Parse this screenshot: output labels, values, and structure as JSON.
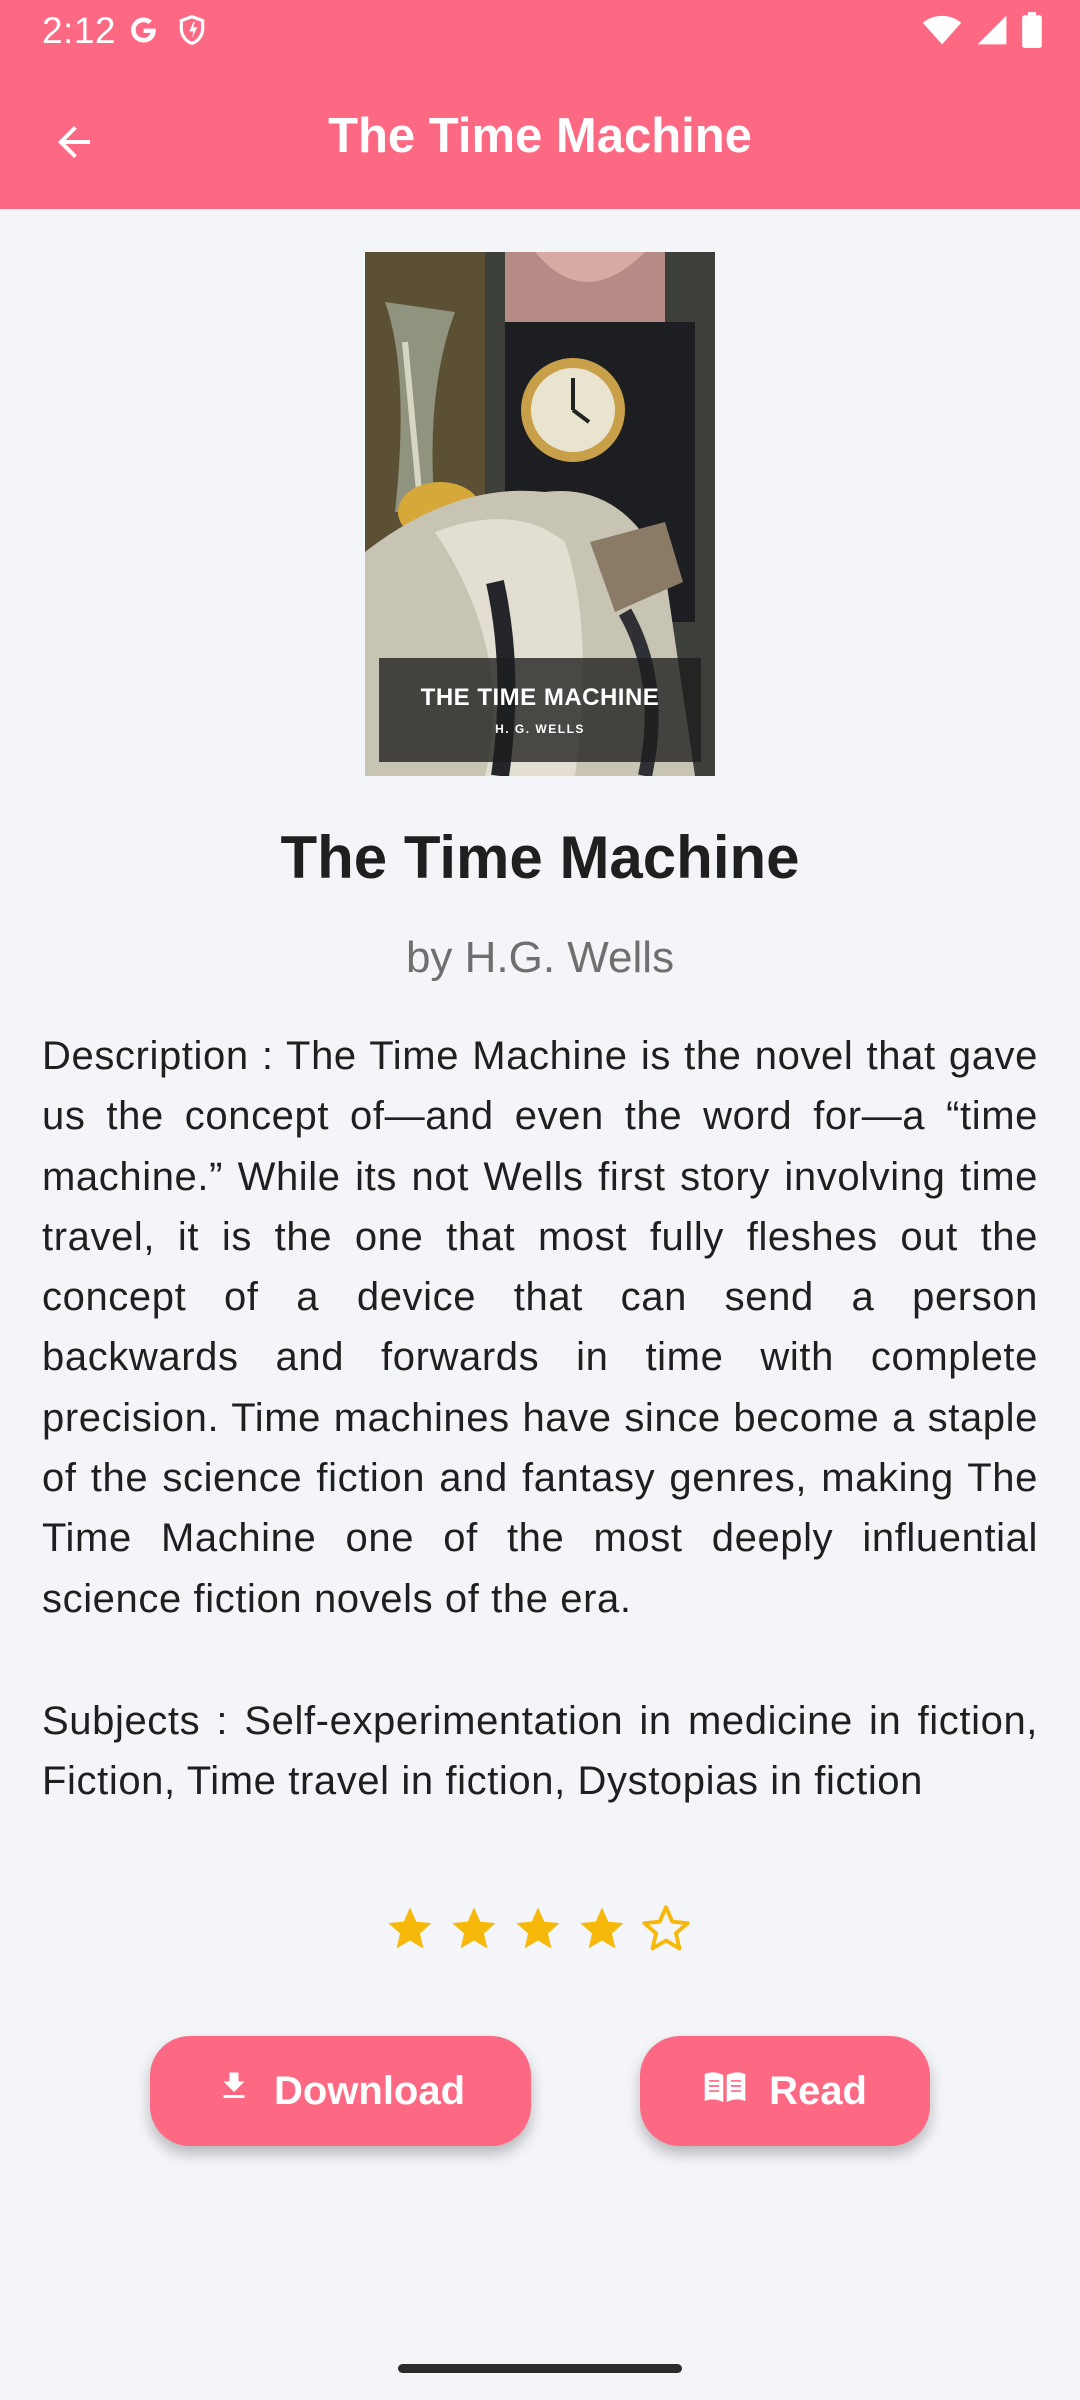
{
  "status_bar": {
    "time": "2:12"
  },
  "app_bar": {
    "title": "The Time Machine"
  },
  "cover": {
    "title": "THE TIME MACHINE",
    "author": "H. G. WELLS"
  },
  "book": {
    "title": "The Time Machine",
    "author": "by H.G. Wells",
    "description": "Description : The Time Machine is the novel that gave us the concept of—and even the word for—a “time machine.” While its not Wells first story involving time travel, it is the one that most fully fleshes out the concept of a device that can send a person backwards and forwards in time with complete precision. Time machines have since become a staple of the science fiction and fantasy genres, making The Time Machine one of the most deeply influential science fiction novels of the era.",
    "subjects": "Subjects : Self-experimentation in medicine in fiction, Fiction, Time travel in fiction, Dystopias in fiction",
    "rating": 4,
    "rating_max": 5
  },
  "actions": {
    "download_label": "Download",
    "read_label": "Read"
  },
  "colors": {
    "accent": "#fd6883",
    "star": "#f6b90b",
    "background": "#f4f5f9"
  },
  "icons": [
    "back-arrow-icon",
    "google-icon",
    "shield-icon",
    "wifi-icon",
    "signal-icon",
    "battery-icon",
    "download-icon",
    "book-open-icon",
    "star-icon"
  ]
}
